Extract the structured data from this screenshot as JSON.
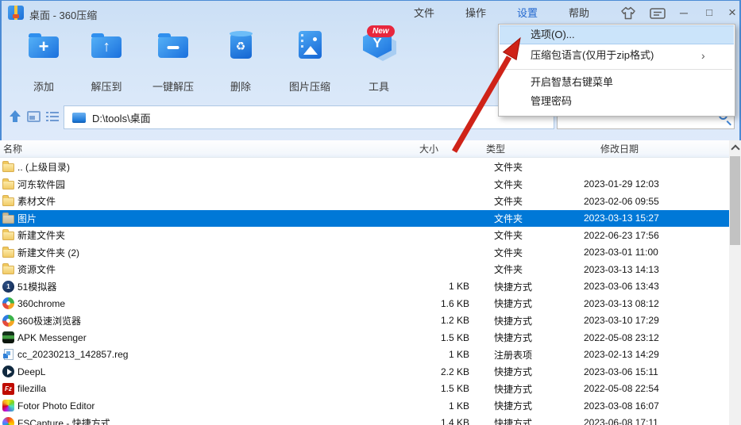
{
  "window": {
    "title": "桌面 - 360压缩",
    "minimize": "─",
    "maximize": "□",
    "close": "×"
  },
  "menubar": {
    "items": [
      {
        "label": "文件"
      },
      {
        "label": "操作"
      },
      {
        "label": "设置",
        "active": true
      },
      {
        "label": "帮助"
      }
    ]
  },
  "dropdown": {
    "submenu_arrow": "›",
    "items": [
      {
        "label": "选项(O)...",
        "highlighted": true
      },
      {
        "label": "压缩包语言(仅用于zip格式)",
        "has_submenu": true
      },
      {
        "label": "开启智慧右键菜单"
      },
      {
        "label": "管理密码"
      }
    ]
  },
  "toolbar": {
    "new_badge": "New",
    "buttons": [
      {
        "label": "添加",
        "icon": "folder-add"
      },
      {
        "label": "解压到",
        "icon": "folder-extract-up"
      },
      {
        "label": "一键解压",
        "icon": "folder-one-click-extract"
      },
      {
        "label": "删除",
        "icon": "trash-recycle"
      },
      {
        "label": "图片压缩",
        "icon": "image-compress"
      },
      {
        "label": "工具",
        "icon": "tools-cube",
        "badge": "New"
      }
    ]
  },
  "addressbar": {
    "path": "D:\\tools\\桌面"
  },
  "search": {
    "value": "",
    "icon": "magnifier"
  },
  "list": {
    "columns": [
      "名称",
      "大小",
      "类型",
      "修改日期"
    ],
    "rows": [
      {
        "icon": "folder",
        "name": ".. (上级目录)",
        "size": "",
        "type": "文件夹",
        "date": ""
      },
      {
        "icon": "folder",
        "name": "河东软件园",
        "size": "",
        "type": "文件夹",
        "date": "2023-01-29 12:03"
      },
      {
        "icon": "folder",
        "name": "素材文件",
        "size": "",
        "type": "文件夹",
        "date": "2023-02-06 09:55"
      },
      {
        "icon": "folder",
        "name": "图片",
        "size": "",
        "type": "文件夹",
        "date": "2023-03-13 15:27",
        "selected": true
      },
      {
        "icon": "folder",
        "name": "新建文件夹",
        "size": "",
        "type": "文件夹",
        "date": "2022-06-23 17:56"
      },
      {
        "icon": "folder",
        "name": "新建文件夹 (2)",
        "size": "",
        "type": "文件夹",
        "date": "2023-03-01 11:00"
      },
      {
        "icon": "folder",
        "name": "资源文件",
        "size": "",
        "type": "文件夹",
        "date": "2023-03-13 14:13"
      },
      {
        "icon": "app-51",
        "name": "51模拟器",
        "size": "1 KB",
        "type": "快捷方式",
        "date": "2023-03-06 13:43"
      },
      {
        "icon": "app-360",
        "name": "360chrome",
        "size": "1.6 KB",
        "type": "快捷方式",
        "date": "2023-03-13 08:12"
      },
      {
        "icon": "app-360",
        "name": "360极速浏览器",
        "size": "1.2 KB",
        "type": "快捷方式",
        "date": "2023-03-10 17:29"
      },
      {
        "icon": "app-apk",
        "name": "APK Messenger",
        "size": "1.5 KB",
        "type": "快捷方式",
        "date": "2022-05-08 23:12"
      },
      {
        "icon": "file-reg",
        "name": "cc_20230213_142857.reg",
        "size": "1 KB",
        "type": "注册表项",
        "date": "2023-02-13 14:29"
      },
      {
        "icon": "app-deepl",
        "name": "DeepL",
        "size": "2.2 KB",
        "type": "快捷方式",
        "date": "2023-03-06 15:11"
      },
      {
        "icon": "app-filezilla",
        "name": "filezilla",
        "size": "1.5 KB",
        "type": "快捷方式",
        "date": "2022-05-08 22:54"
      },
      {
        "icon": "app-fotor",
        "name": "Fotor Photo Editor",
        "size": "1 KB",
        "type": "快捷方式",
        "date": "2023-03-08 16:07"
      },
      {
        "icon": "app-fscapture",
        "name": "FSCapture - 快捷方式",
        "size": "1.4 KB",
        "type": "快捷方式",
        "date": "2023-06-08 17:11"
      }
    ]
  },
  "colors": {
    "selection": "#0078d7",
    "menu_highlight": "#cbe4fa",
    "chrome_blue": "#d6e6f8",
    "toolbar_icon_blue": "#1a70dd",
    "badge_red": "#e8273d",
    "arrow_red": "#cf2318",
    "folder_yellow": "#f1cb66"
  }
}
